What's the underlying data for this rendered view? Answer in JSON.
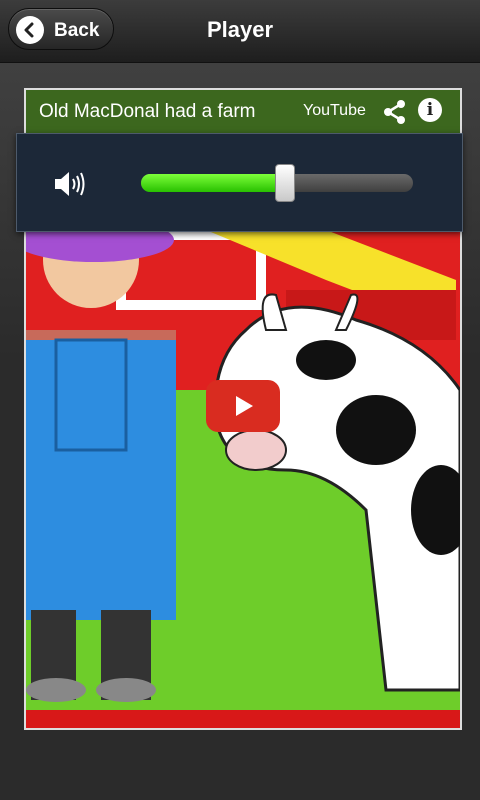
{
  "header": {
    "back_label": "Back",
    "title": "Player"
  },
  "video": {
    "title": "Old MacDonal had a farm",
    "provider_label": "YouTube",
    "info_glyph": "i"
  },
  "volume": {
    "level": 0.53,
    "icon": "speaker-icon"
  },
  "colors": {
    "slider_fill": "#33cc00",
    "play_button": "#d92c20",
    "panel_bg": "#1c2838"
  }
}
